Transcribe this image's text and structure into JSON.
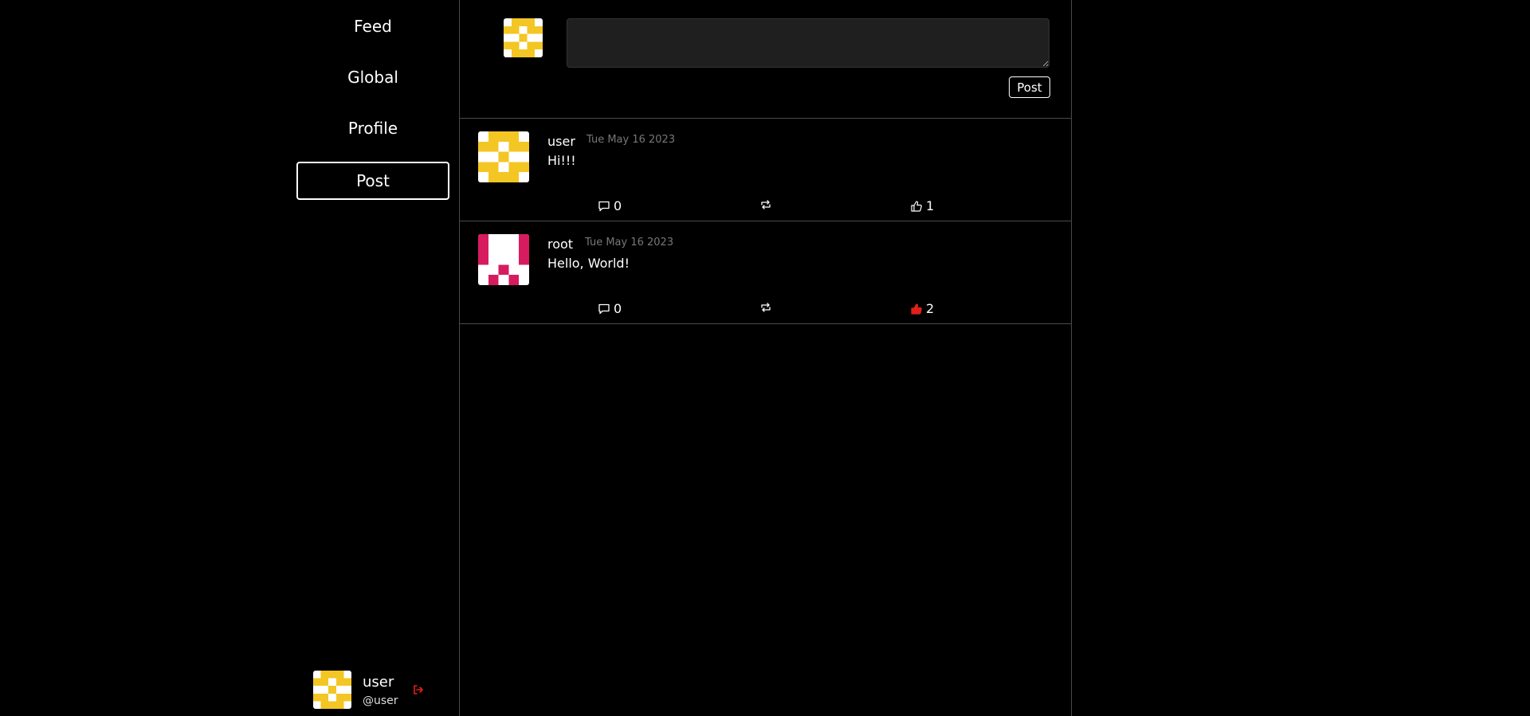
{
  "nav": {
    "feed": "Feed",
    "global": "Global",
    "profile": "Profile",
    "post": "Post"
  },
  "account": {
    "name": "user",
    "handle": "@user",
    "avatar_icon": "identicon-yellow-icon",
    "logout_icon": "logout-icon"
  },
  "composer": {
    "value": "",
    "placeholder": "",
    "post_label": "Post"
  },
  "posts": [
    {
      "author": "user",
      "date": "Tue May 16 2023",
      "text": "Hi!!!",
      "comments": "0",
      "likes": "1",
      "liked": false,
      "avatar_color": "#f3c623"
    },
    {
      "author": "root",
      "date": "Tue May 16 2023",
      "text": "Hello, World!",
      "comments": "0",
      "likes": "2",
      "liked": true,
      "avatar_color": "#d81b5f"
    }
  ],
  "colors": {
    "background": "#000000",
    "border": "#4a4a4a",
    "liked": "#e0201b",
    "logout": "#e0201b",
    "date": "#777777"
  }
}
